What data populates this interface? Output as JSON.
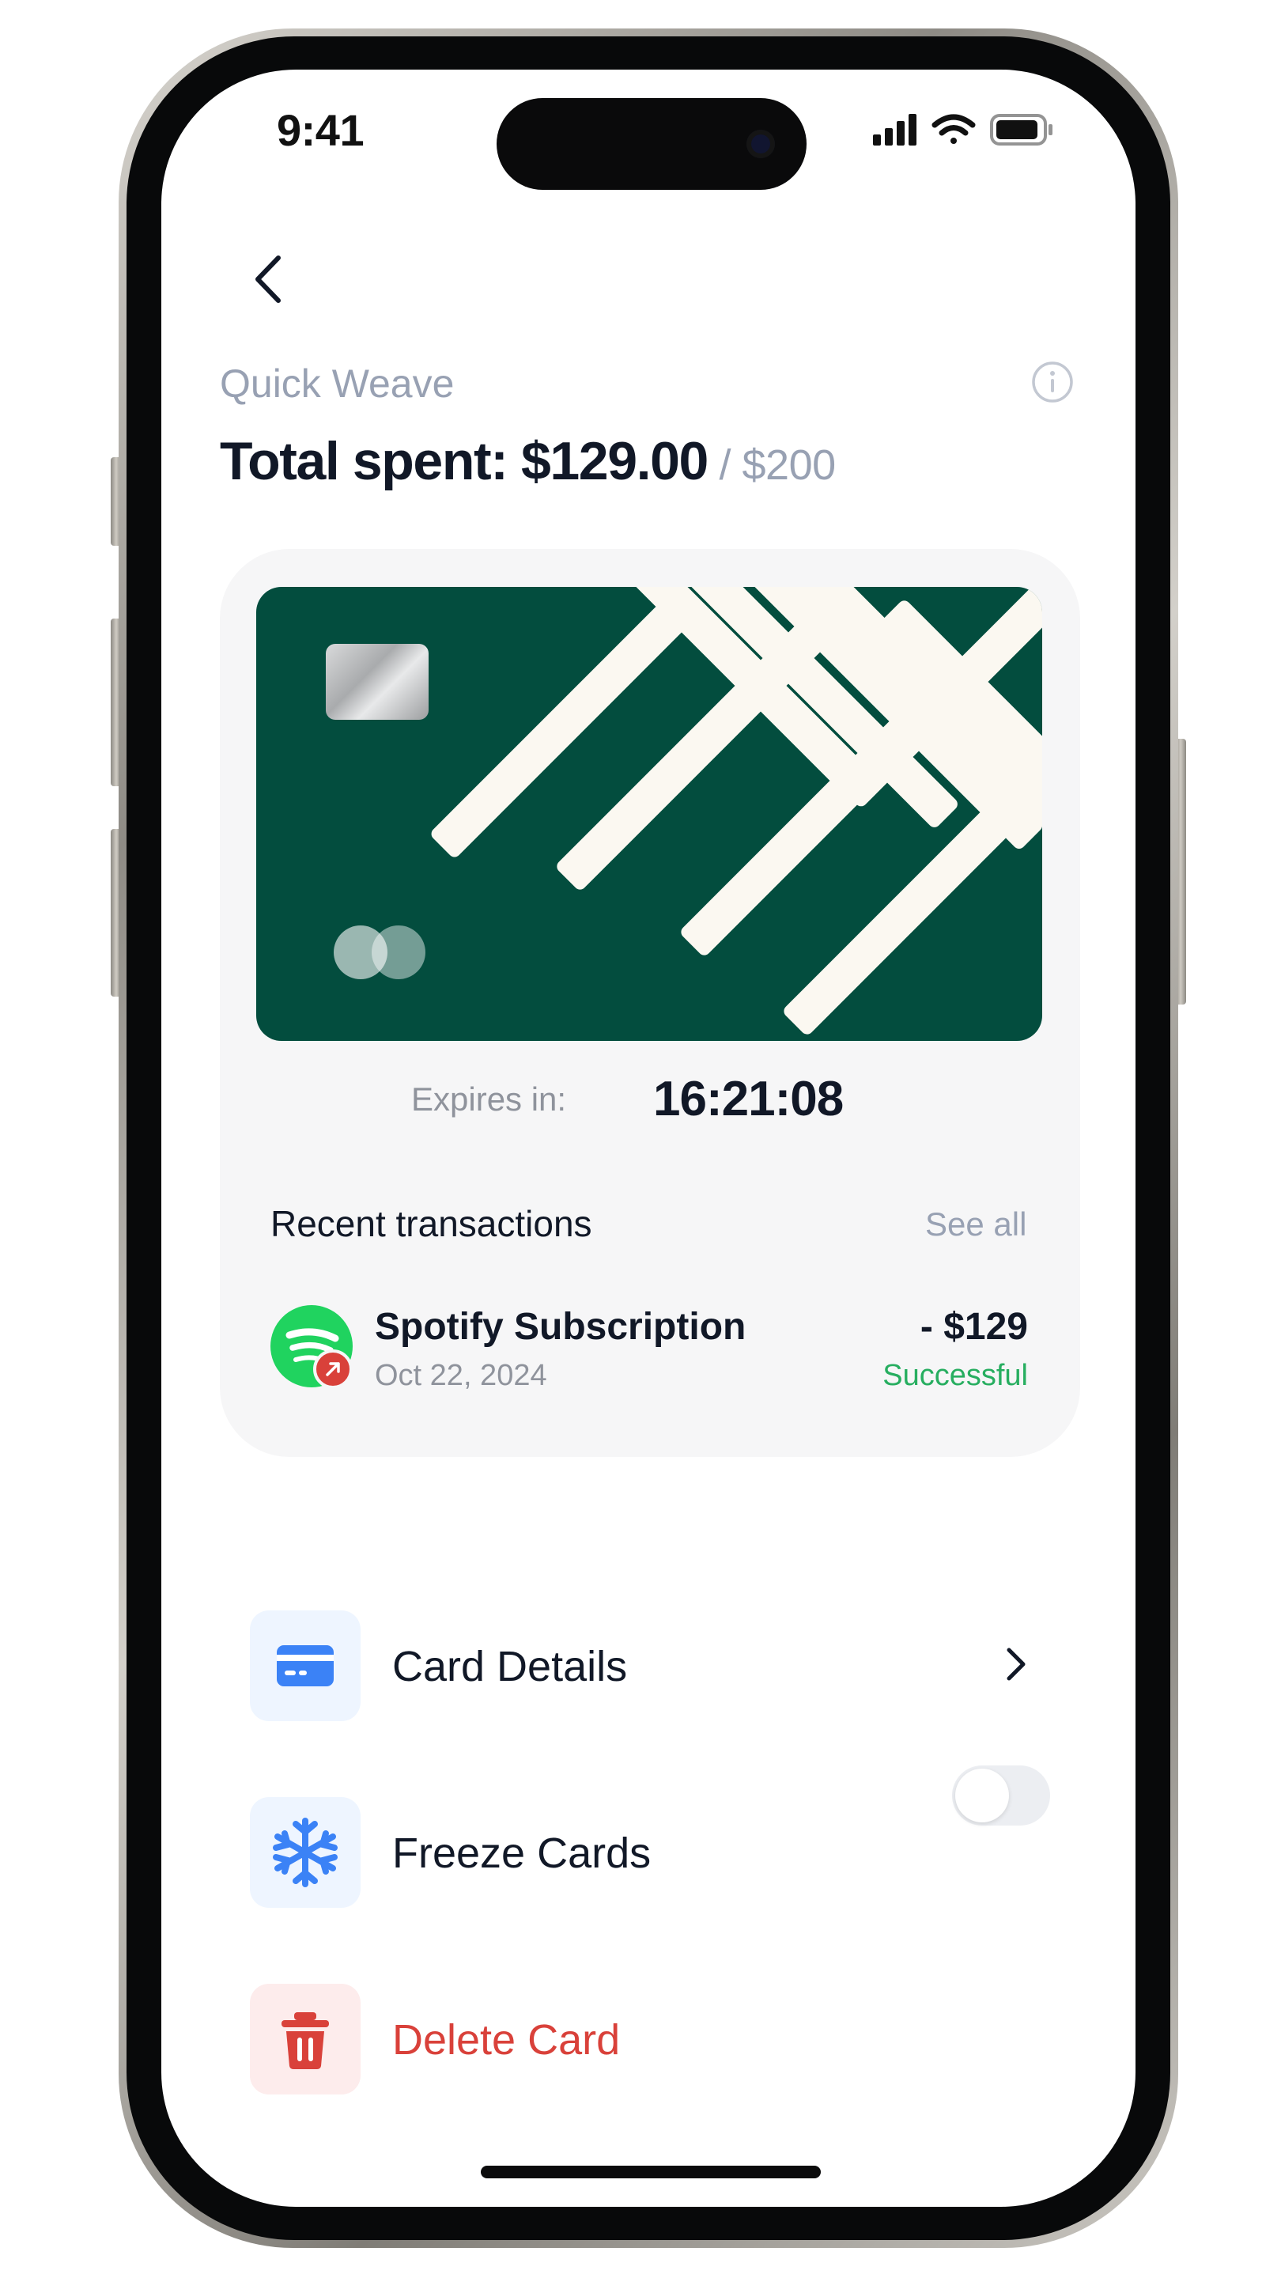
{
  "status_bar": {
    "time": "9:41"
  },
  "header": {
    "card_name": "Quick Weave",
    "total_prefix": "Total spent: ",
    "total_spent": "$129.00",
    "limit_sep": " / ",
    "limit": "$200"
  },
  "card": {
    "expires_label": "Expires in:",
    "expires_value": "16:21:08",
    "color": "#034d3e"
  },
  "transactions": {
    "title": "Recent transactions",
    "see_all": "See all",
    "items": [
      {
        "name": "Spotify Subscription",
        "date": "Oct 22, 2024",
        "amount": "- $129",
        "status": "Successful"
      }
    ]
  },
  "actions": {
    "card_details": "Card Details",
    "freeze_cards": "Freeze Cards",
    "freeze_enabled": false,
    "delete_card": "Delete Card"
  },
  "colors": {
    "accent_blue": "#3b82f6",
    "danger": "#d9413a",
    "success": "#27ae60"
  }
}
